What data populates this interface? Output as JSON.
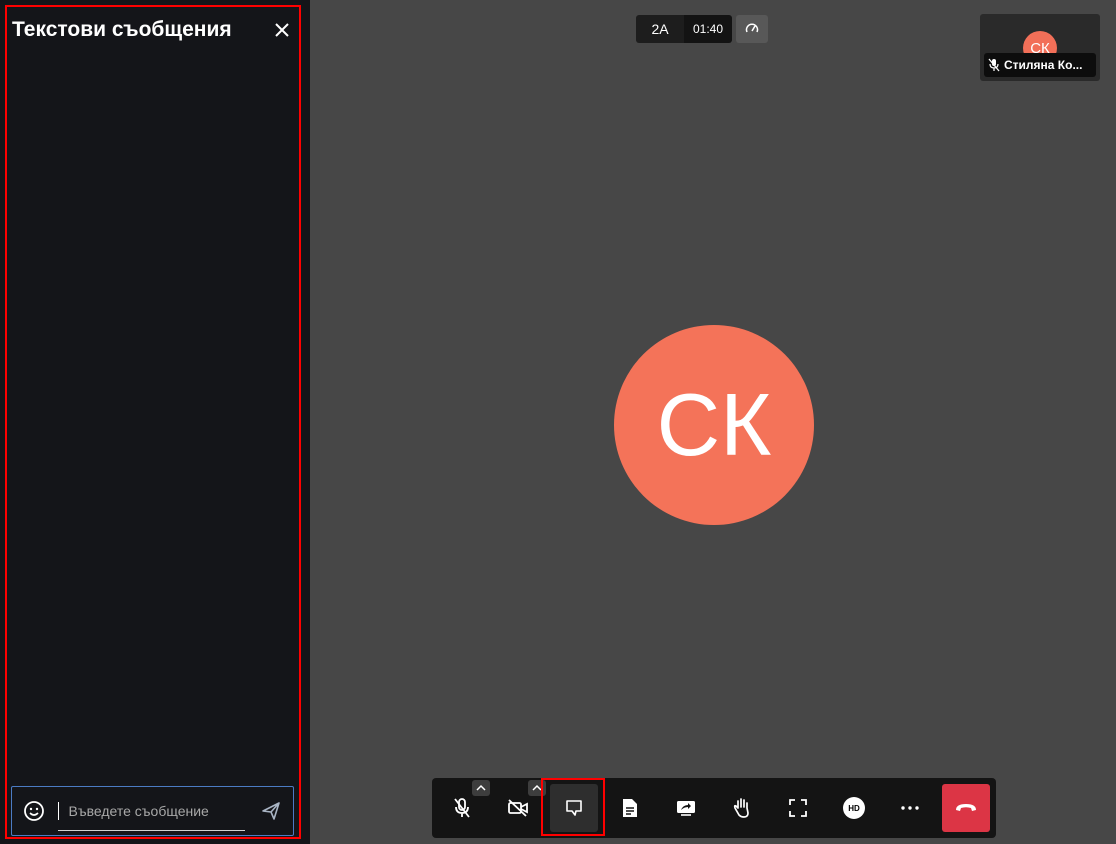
{
  "chat": {
    "title": "Текстови съобщения",
    "input_placeholder": "Въведете съобщение"
  },
  "top_bar": {
    "room_label": "2А",
    "timer": "01:40"
  },
  "thumbnail": {
    "initials": "СК",
    "name": "Стиляна Ко..."
  },
  "main_stage": {
    "initials": "СК",
    "avatar_color": "#f47359"
  },
  "toolbar": {
    "hd_label": "HD",
    "hangup_color": "#dc3545"
  },
  "icons": [
    "close-icon",
    "emoji-icon",
    "send-icon",
    "speed-icon",
    "mic-off-icon",
    "camera-off-icon",
    "chat-icon",
    "document-icon",
    "share-screen-icon",
    "raise-hand-icon",
    "fullscreen-icon",
    "hd-icon",
    "more-icon",
    "hangup-icon"
  ]
}
